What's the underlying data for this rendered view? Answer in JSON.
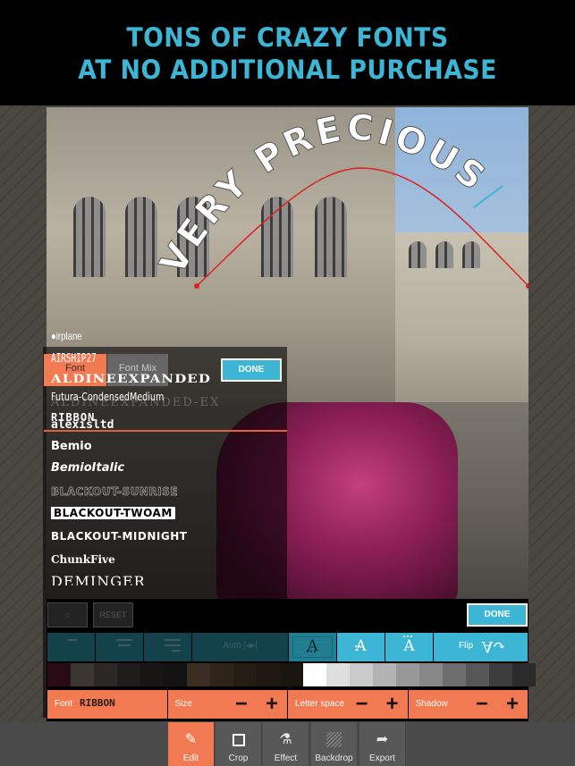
{
  "banner": {
    "line1": "TONS OF CRAZY FONTS",
    "line2": "AT NO ADDITIONAL PURCHASE",
    "color": "#3db6d6"
  },
  "canvas": {
    "curved_text": "VERY PRECIOUS",
    "path_color": "#e02020",
    "handle_color": "#3db6d6"
  },
  "font_panel": {
    "tabs": [
      {
        "label": "Font",
        "active": true
      },
      {
        "label": "Font Mix",
        "active": false
      }
    ],
    "done_label": "DONE",
    "current_font_name": "Futura-CondensedMedium",
    "current_font_preview": "RIBBON",
    "fonts": [
      "●irplane",
      "AIRSHIP27",
      "ALDINEEXPANDED",
      "ALDINEEXPANDED-EX",
      "alexisltd",
      "Bemio",
      "BemioItalic",
      "BLACKOUT-SUNRISE",
      "BLACKOUT-TWOAM",
      "BLACKOUT-MIDNIGHT",
      "ChunkFive",
      "DEMINGER"
    ]
  },
  "background_controls": {
    "reset_label": "RESET"
  },
  "text_controls": {
    "done_label": "DONE",
    "auto_label": "Auto",
    "auto_icon": "|◂▸|",
    "glyph_a": "A",
    "flip_label": "Flip",
    "flip_icon": "↷"
  },
  "swatches": [
    "#2a0a14",
    "#3b3632",
    "#2b2826",
    "#1f1d1b",
    "#171614",
    "#131313",
    "#3a2e22",
    "#2e241a",
    "#251c13",
    "#1e1710",
    "#1b1510",
    "#ffffff",
    "#dedede",
    "#cacaca",
    "#b3b3b3",
    "#989898",
    "#878787",
    "#6e6e6e",
    "#575757",
    "#3d3d3d",
    "#2b2b2b"
  ],
  "selected_swatch": 11,
  "property_bar": {
    "font_label": "Font",
    "font_value": "RIBBON",
    "size_label": "Size",
    "letter_space_label": "Letter space",
    "shadow_label": "Shadow",
    "minus": "−",
    "plus": "+"
  },
  "tabbar": {
    "items": [
      {
        "label": "Edit",
        "icon": "✎",
        "active": true
      },
      {
        "label": "Crop",
        "icon": "crop",
        "active": false
      },
      {
        "label": "Effect",
        "icon": "⚗",
        "active": false
      },
      {
        "label": "Backdrop",
        "icon": "backdrop",
        "active": false
      },
      {
        "label": "Export",
        "icon": "➦",
        "active": false
      }
    ]
  }
}
